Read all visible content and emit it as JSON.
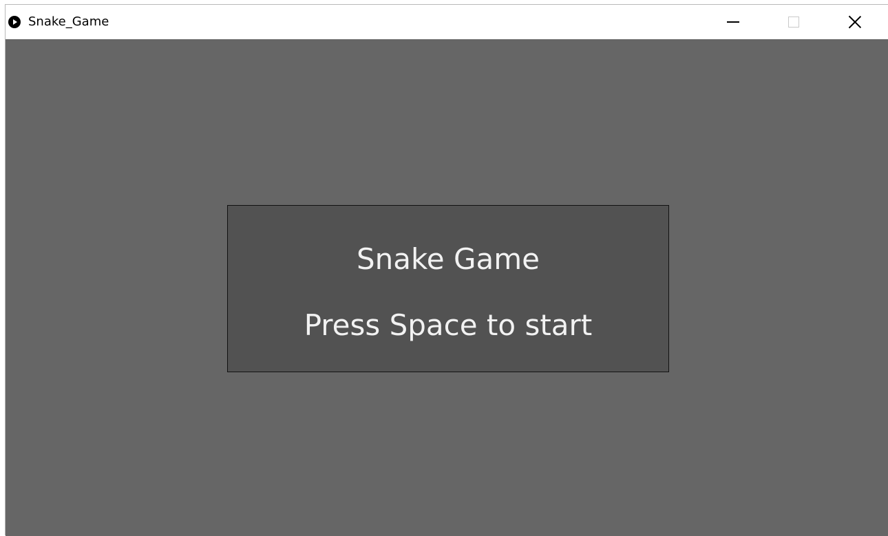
{
  "window": {
    "title": "Snake_Game",
    "icon": "play-circle-icon",
    "controls": {
      "minimize_icon": "minimize-icon",
      "maximize_icon": "maximize-icon",
      "close_icon": "close-icon"
    }
  },
  "game": {
    "background_color": "#666666",
    "panel_color": "#525252",
    "title": "Snake Game",
    "hint": "Press Space to start"
  }
}
